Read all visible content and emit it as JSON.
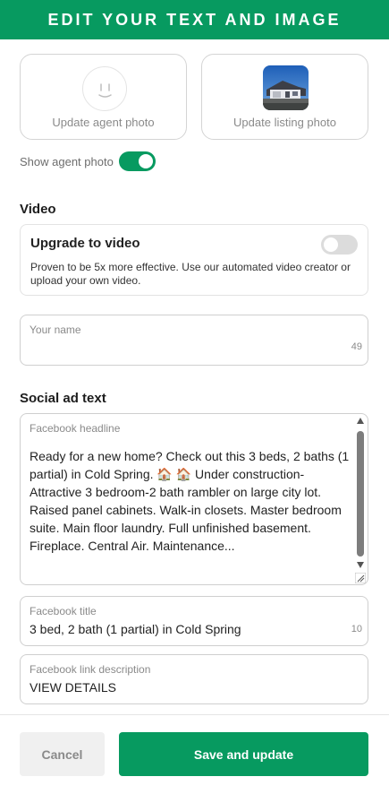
{
  "header": {
    "title": "EDIT YOUR TEXT AND IMAGE"
  },
  "photos": {
    "agent_label": "Update agent photo",
    "listing_label": "Update listing photo"
  },
  "agent_toggle": {
    "label": "Show agent photo",
    "on": true
  },
  "video": {
    "section_title": "Video",
    "card_title": "Upgrade to video",
    "description": "Proven to be 5x more effective. Use our automated video creator or upload your own video.",
    "upgrade_on": false
  },
  "name_field": {
    "label": "Your name",
    "value": "",
    "counter": "49"
  },
  "social": {
    "section_title": "Social ad text"
  },
  "headline_field": {
    "label": "Facebook headline",
    "value": "Ready for a new home? Check out this 3 beds, 2 baths (1 partial) in Cold Spring. 🏠 🏠 Under construction-Attractive 3 bedroom-2 bath rambler on large city lot. Raised panel cabinets. Walk-in closets. Master bedroom suite. Main floor laundry. Full unfinished basement. Fireplace. Central Air. Maintenance..."
  },
  "title_field": {
    "label": "Facebook title",
    "value": "3 bed, 2 bath (1 partial) in Cold Spring",
    "counter": "10"
  },
  "link_desc_field": {
    "label": "Facebook link description",
    "value": "VIEW DETAILS"
  },
  "footer": {
    "cancel_label": "Cancel",
    "save_label": "Save and update"
  },
  "colors": {
    "accent": "#079a60",
    "toggle_off": "#dcdcdc"
  }
}
